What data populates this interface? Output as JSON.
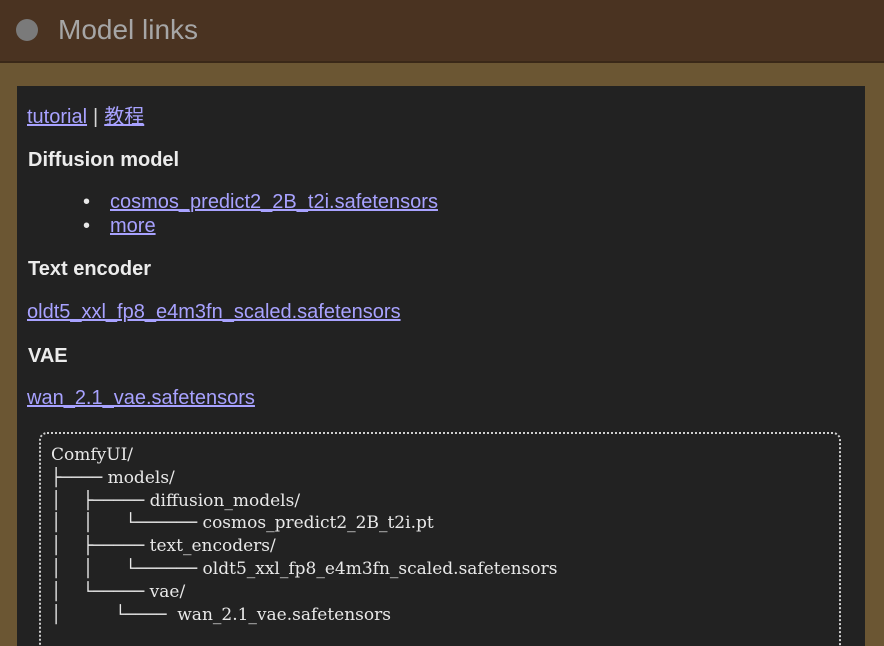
{
  "window": {
    "title": "Model links"
  },
  "links_top": {
    "tutorial": "tutorial",
    "separator": "|",
    "tutorial_cn": "教程"
  },
  "sections": {
    "diffusion": {
      "heading": "Diffusion model",
      "items": [
        "cosmos_predict2_2B_t2i.safetensors",
        "more"
      ]
    },
    "text_encoder": {
      "heading": "Text encoder",
      "link": "oldt5_xxl_fp8_e4m3fn_scaled.safetensors"
    },
    "vae": {
      "heading": "VAE",
      "link": "wan_2.1_vae.safetensors"
    }
  },
  "tree": {
    "lines": [
      "ComfyUI/",
      "├──── models/",
      "│    ├───── diffusion_models/",
      "│    │      └────── cosmos_predict2_2B_t2i.pt",
      "│    ├───── text_encoders/",
      "│    │      └────── oldt5_xxl_fp8_e4m3fn_scaled.safetensors",
      "│    └───── vae/",
      "│          └────  wan_2.1_vae.safetensors"
    ]
  }
}
